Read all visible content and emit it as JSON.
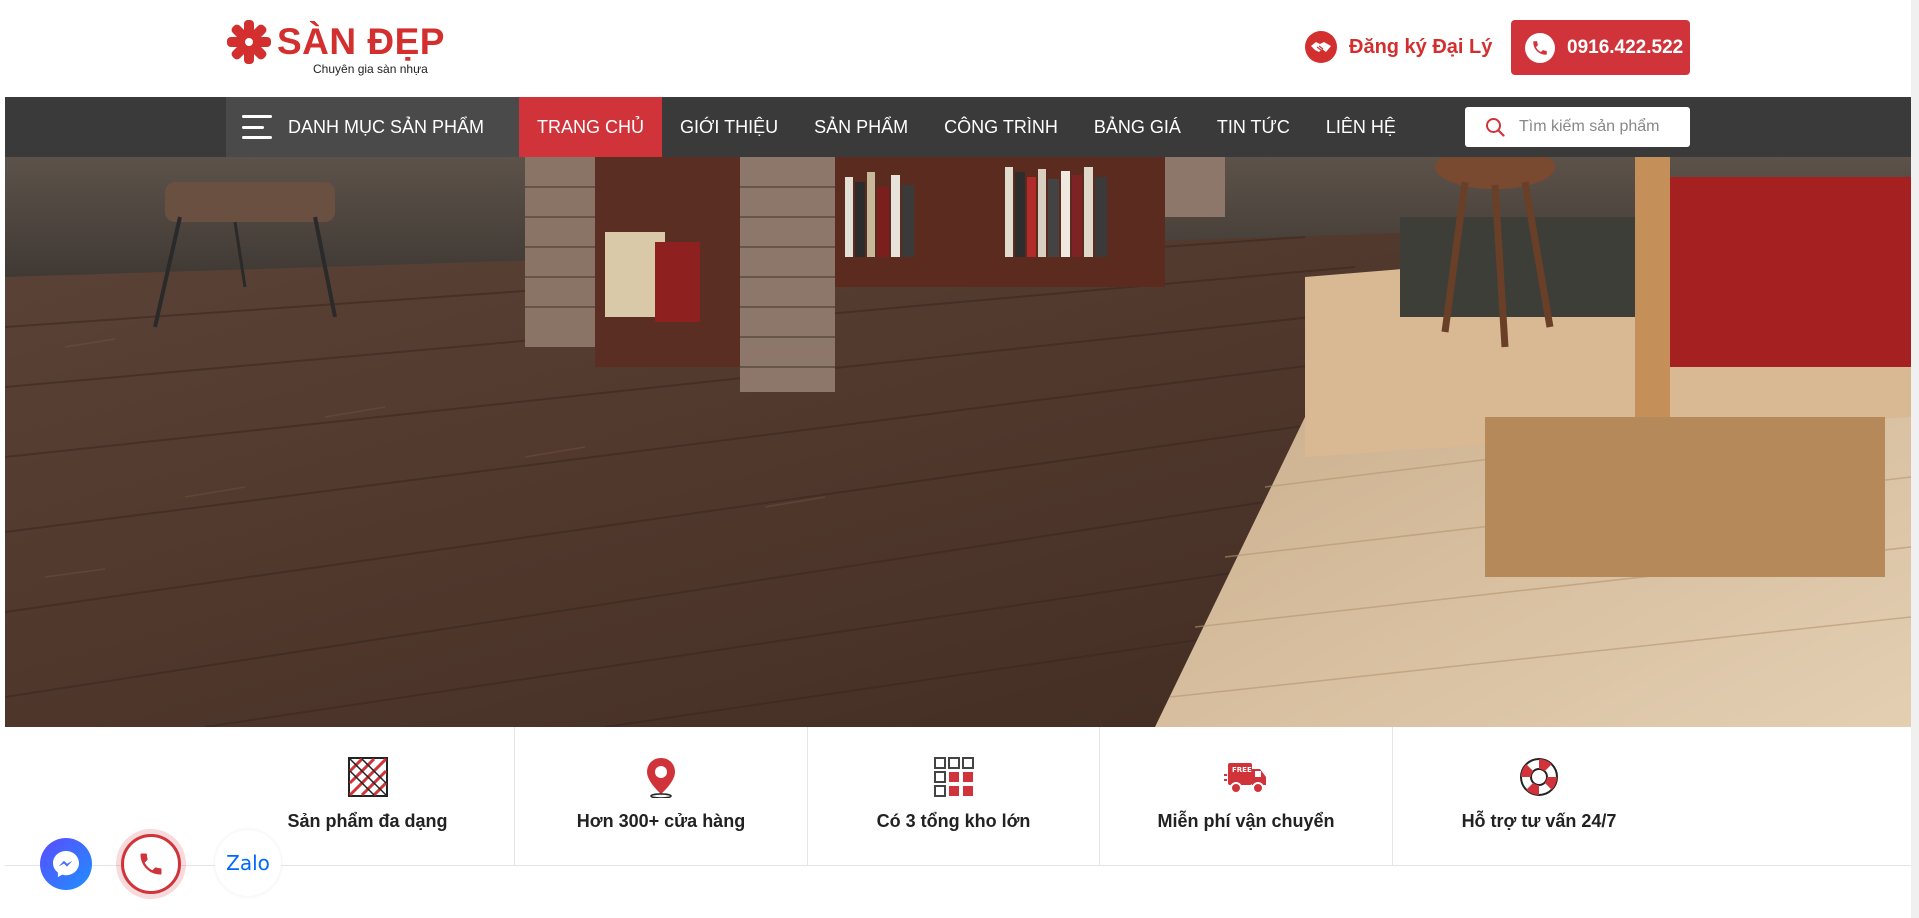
{
  "brand": {
    "name": "SÀN ĐẸP",
    "tagline": "Chuyên gia sàn nhựa",
    "color": "#d32f2f"
  },
  "header": {
    "dealer_label": "Đăng ký Đại Lý",
    "dealer_icon": "handshake-icon",
    "hotline": "0916.422.522",
    "hotline_icon": "phone-icon"
  },
  "nav": {
    "category_label": "DANH MỤC SẢN PHẨM",
    "items": [
      {
        "label": "TRANG CHỦ",
        "active": true
      },
      {
        "label": "GIỚI THIỆU",
        "active": false
      },
      {
        "label": "SẢN PHẨM",
        "active": false
      },
      {
        "label": "CÔNG TRÌNH",
        "active": false
      },
      {
        "label": "BẢNG GIÁ",
        "active": false
      },
      {
        "label": "TIN TỨC",
        "active": false
      },
      {
        "label": "LIÊN HỆ",
        "active": false
      }
    ],
    "search_placeholder": "Tìm kiếm sản phẩm",
    "bar_color": "#3a3a3a",
    "active_color": "#d0343a"
  },
  "hero": {
    "image": "wood-vinyl-floor-living-room-photo"
  },
  "features": [
    {
      "label": "Sản phẩm đa dạng",
      "icon": "tiles-icon"
    },
    {
      "label": "Hơn 300+ cửa hàng",
      "icon": "map-pin-icon"
    },
    {
      "label": "Có 3 tổng kho lớn",
      "icon": "warehouse-grid-icon"
    },
    {
      "label": "Miễn phí vận chuyển",
      "icon": "free-shipping-truck-icon"
    },
    {
      "label": "Hỗ trợ tư vấn 24/7",
      "icon": "lifebuoy-icon"
    }
  ],
  "floating": {
    "zalo_label": "Zalo",
    "messenger_icon": "messenger-icon",
    "call_icon": "phone-icon"
  }
}
